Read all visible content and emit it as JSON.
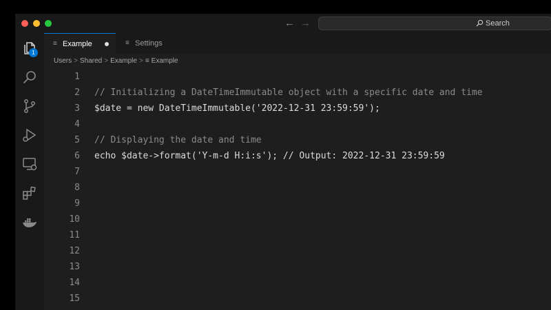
{
  "window": {
    "search_placeholder": "Search",
    "nav_back_icon": "arrow-left-icon",
    "nav_forward_icon": "arrow-right-icon"
  },
  "activity_bar": {
    "items": [
      {
        "name": "explorer",
        "icon": "files-icon",
        "badge": "1"
      },
      {
        "name": "search",
        "icon": "search-icon"
      },
      {
        "name": "source-control",
        "icon": "source-control-icon"
      },
      {
        "name": "run-and-debug",
        "icon": "run-debug-icon"
      },
      {
        "name": "remote-explorer",
        "icon": "remote-explorer-icon"
      },
      {
        "name": "extensions",
        "icon": "extensions-icon"
      },
      {
        "name": "docker",
        "icon": "docker-icon"
      }
    ]
  },
  "tabs": [
    {
      "label": "Example",
      "active": true,
      "modified": true
    },
    {
      "label": "Settings",
      "active": false
    }
  ],
  "breadcrumb": [
    "Users",
    "Shared",
    "Example",
    "Example"
  ],
  "editor": {
    "lines": [
      {
        "n": "1",
        "text": ""
      },
      {
        "n": "2",
        "text": "// Initializing a DateTimeImmutable object with a specific date and time",
        "comment": true
      },
      {
        "n": "3",
        "text": "$date = new DateTimeImmutable('2022-12-31 23:59:59');"
      },
      {
        "n": "4",
        "text": ""
      },
      {
        "n": "5",
        "text": "// Displaying the date and time",
        "comment": true
      },
      {
        "n": "6",
        "text": "echo $date->format('Y-m-d H:i:s'); // Output: 2022-12-31 23:59:59"
      },
      {
        "n": "7",
        "text": ""
      },
      {
        "n": "8",
        "text": ""
      },
      {
        "n": "9",
        "text": ""
      },
      {
        "n": "10",
        "text": ""
      },
      {
        "n": "11",
        "text": ""
      },
      {
        "n": "12",
        "text": ""
      },
      {
        "n": "13",
        "text": ""
      },
      {
        "n": "14",
        "text": ""
      },
      {
        "n": "15",
        "text": ""
      }
    ]
  },
  "colors": {
    "accent": "#0078d4",
    "editor_bg": "#1e1e1e",
    "comment": "#8b8b8b",
    "code": "#dcdcdc"
  }
}
